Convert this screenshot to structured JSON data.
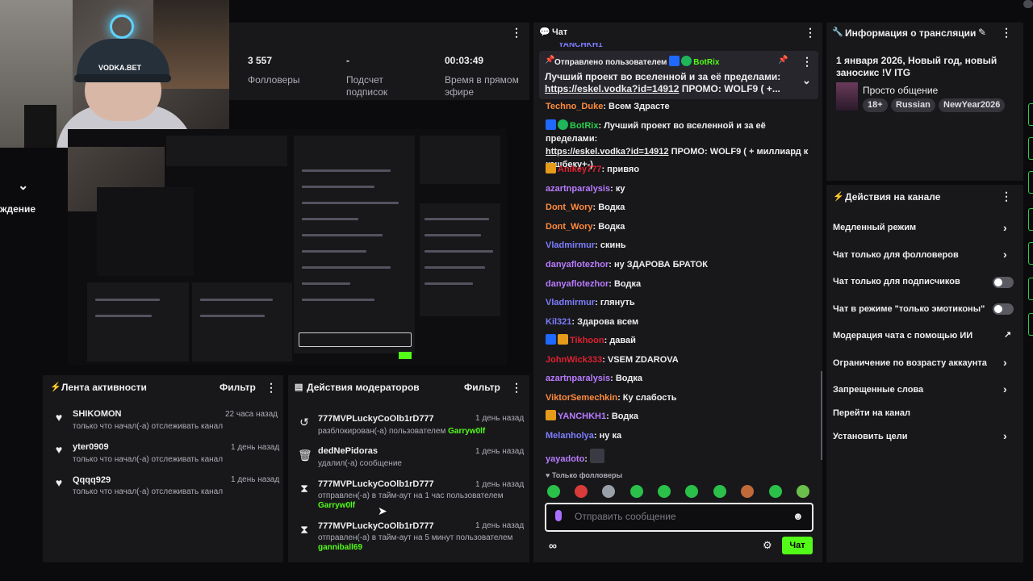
{
  "stats": {
    "followers_value": "3 557",
    "followers_label": "Фолловеры",
    "subs_value": "-",
    "subs_label": "Подсчет подписок",
    "uptime_value": "00:03:49",
    "uptime_label": "Время в прямом эфире"
  },
  "left_partial_label": "ждение",
  "webcam_cap_text": "VODKA.BET",
  "activity": {
    "title": "Лента активности",
    "filter": "Фильтр",
    "items": [
      {
        "name": "SHIKOMON",
        "sub": "только что начал(-а) отслеживать канал",
        "time": "22 часа назад"
      },
      {
        "name": "yter0909",
        "sub": "только что начал(-а) отслеживать канал",
        "time": "1 день назад"
      },
      {
        "name": "Qqqq929",
        "sub": "только что начал(-а) отслеживать канал",
        "time": "1 день назад"
      }
    ]
  },
  "modactions": {
    "title": "Действия модераторов",
    "filter": "Фильтр",
    "items": [
      {
        "name": "777MVPLuckyCoOlb1rD777",
        "sub": "разблокирован(-а) пользователем",
        "by": "Garryw0lf",
        "time": "1 день назад",
        "icon": "unban-icon"
      },
      {
        "name": "dedNePidoras",
        "sub": "удалил(-а) сообщение",
        "by": "",
        "time": "1 день назад",
        "icon": "trash-icon"
      },
      {
        "name": "777MVPLuckyCoOlb1rD777",
        "sub": "отправлен(-а) в тайм-аут на 1 час пользователем",
        "by": "Garryw0lf",
        "time": "1 день назад",
        "icon": "hourglass-icon"
      },
      {
        "name": "777MVPLuckyCoOlb1rD777",
        "sub": "отправлен(-а) в тайм-аут на 5 минут пользователем",
        "by": "ganniball69",
        "time": "1 день назад",
        "icon": "hourglass-icon"
      }
    ]
  },
  "chat": {
    "title": "Чат",
    "top_partial": "YANCHKH1",
    "pinned": {
      "by_label": "Отправлено пользователем",
      "by_user": "BotRix",
      "text": "Лучший проект во вселенной и за её пределами:",
      "link": "https://eskel.vodka?id=14912",
      "promo": "ПРОМО: WOLF9 ( +..."
    },
    "messages": [
      {
        "user": "Techno_Duke",
        "color": "#ff8a3d",
        "text": "Всем Здрасте"
      },
      {
        "user": "BotRix",
        "color": "#2bd14b",
        "text": "Лучший проект во вселенной и за её пределами:",
        "link": "https://eskel.vodka?id=14912",
        "after": "ПРОМО: WOLF9 ( + миллиард к кэшбеку+-)"
      },
      {
        "user": "Anikey777",
        "color": "#e0212e",
        "text": "привяо"
      },
      {
        "user": "azartnparalysis",
        "color": "#b97bff",
        "text": "ку"
      },
      {
        "user": "Dont_Wory",
        "color": "#ff8a3d",
        "text": "Водка"
      },
      {
        "user": "Dont_Wory",
        "color": "#ff8a3d",
        "text": "Водка"
      },
      {
        "user": "Vladmirmur",
        "color": "#7d7dff",
        "text": "скинь"
      },
      {
        "user": "danyaflotezhor",
        "color": "#b97bff",
        "text": "ну ЗДАРОВА БРАТОК"
      },
      {
        "user": "danyaflotezhor",
        "color": "#b97bff",
        "text": "Водка"
      },
      {
        "user": "Vladmirmur",
        "color": "#7d7dff",
        "text": "глянуть"
      },
      {
        "user": "Kil321",
        "color": "#7d7dff",
        "text": "Здарова всем"
      },
      {
        "user": "Tikhoon",
        "color": "#e0212e",
        "text": "давай"
      },
      {
        "user": "JohnWick333",
        "color": "#e0212e",
        "text": "VSEM ZDAROVA"
      },
      {
        "user": "azartnparalysis",
        "color": "#b97bff",
        "text": "Водка"
      },
      {
        "user": "ViktorSemechkin",
        "color": "#ff8a3d",
        "text": "Ку слабость"
      },
      {
        "user": "YANCHKH1",
        "color": "#b97bff",
        "text": "Водка"
      },
      {
        "user": "Melanholya",
        "color": "#7d7dff",
        "text": "ну ка"
      },
      {
        "user": "yayadoto",
        "color": "#b97bff",
        "text": ""
      }
    ],
    "followers_only": "Только фолловеры",
    "input_placeholder": "Отправить сообщение",
    "send_label": "Чат"
  },
  "info": {
    "title": "Информация о трансляции",
    "stream_title": "1 января 2026, Новый год, новый заносикс !V ITG",
    "category": "Просто общение",
    "tags": [
      "18+",
      "Russian",
      "NewYear2026"
    ]
  },
  "actions": {
    "title": "Действия на канале",
    "items": [
      {
        "label": "Медленный режим",
        "control": "chevron"
      },
      {
        "label": "Чат только для фолловеров",
        "control": "chevron"
      },
      {
        "label": "Чат только для подписчиков",
        "control": "toggle"
      },
      {
        "label": "Чат в режиме \"только эмотиконы\"",
        "control": "toggle"
      },
      {
        "label": "Модерация чата с помощью ИИ",
        "control": "external"
      },
      {
        "label": "Ограничение по возрасту аккаунта",
        "control": "chevron"
      },
      {
        "label": "Запрещенные слова",
        "control": "chevron"
      },
      {
        "label": "Перейти на канал",
        "control": "none"
      },
      {
        "label": "Установить цели",
        "control": "chevron"
      }
    ]
  },
  "colors": {
    "accent_green": "#53fc18",
    "panel": "#18181b",
    "bg": "#0b0b0d"
  }
}
